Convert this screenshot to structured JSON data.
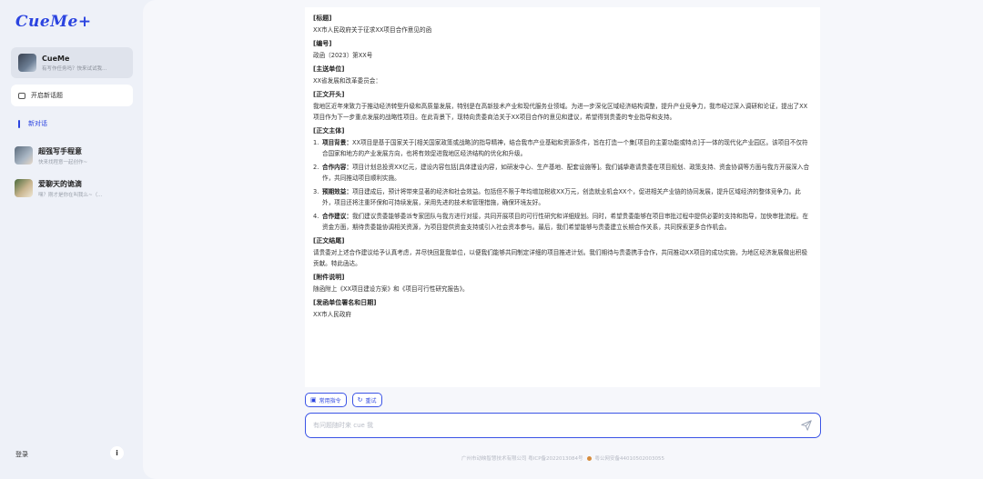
{
  "sidebar": {
    "logo": "CueMe+",
    "agent": {
      "name": "CueMe",
      "sub": "有写作任务吗？快来试试我..."
    },
    "new_topic": "开启新话题",
    "active_history": "新对话",
    "chats": [
      {
        "name": "超强写手程意",
        "sub": "快来找程意一起创作~"
      },
      {
        "name": "爱聊天的诡滴",
        "sub": "嘿？刚才是你在叫我么~（..."
      }
    ],
    "login": "登录"
  },
  "doc": {
    "sections": [
      {
        "title": "[标题]",
        "text": "XX市人民政府关于征求XX项目合作意见的函"
      },
      {
        "title": "[编号]",
        "text": "政函〔2023〕第XX号"
      },
      {
        "title": "[主送单位]",
        "text": "XX省发展和改革委员会："
      },
      {
        "title": "[正文开头]",
        "text": "我地区近年来致力于推动经济转型升级和高质量发展，特别是在高新技术产业和现代服务业领域。为进一步深化区域经济结构调整，提升产业竞争力，我市经过深入调研和论证，提出了XX项目作为下一步重点发展的战略性项目。在此背景下，现特向贵委商洽关于XX项目合作的意见和建议，希望得到贵委的专业指导和支持。"
      }
    ],
    "body_title": "[正文主体]",
    "items": [
      {
        "num": "1.",
        "label": "项目背景：",
        "text": "XX项目是基于国家关于[相关国家政策或战略]的指导精神，结合我市产业基础和资源条件，旨在打造一个集[项目的主要功能或特点]于一体的现代化产业园区。该项目不仅符合国家和地方的产业发展方向，也将有效促进我地区经济结构的优化和升级。"
      },
      {
        "num": "2.",
        "label": "合作内容：",
        "text": "项目计划总投资XX亿元，建设内容包括[具体建设内容，如研发中心、生产基地、配套设施等]。我们诚挚邀请贵委在项目规划、政策支持、资金协调等方面与我方开展深入合作，共同推动项目顺利实施。"
      },
      {
        "num": "3.",
        "label": "预期效益：",
        "text": "项目建成后，预计将带来显著的经济和社会效益。包括但不限于年均增加税收XX万元，创造就业机会XX个，促进相关产业链的协同发展，提升区域经济的整体竞争力。此外，项目还将注重环保和可持续发展，采用先进的技术和管理措施，确保环境友好。"
      },
      {
        "num": "4.",
        "label": "合作建议：",
        "text": "我们建议贵委能够委派专家团队与我方进行对接，共同开展项目的可行性研究和详细规划。同时，希望贵委能够在项目审批过程中提供必要的支持和指导，加快审批流程。在资金方面，期待贵委能协调相关资源，为项目提供资金支持或引入社会资本参与。最后，我们希望能够与贵委建立长期合作关系，共同探索更多合作机会。"
      }
    ],
    "sections_after": [
      {
        "title": "[正文结尾]",
        "text": "请贵委对上述合作建议给予认真考虑，并尽快回复我单位，以便我们能够共同制定详细的项目推进计划。我们期待与贵委携手合作，共同推动XX项目的成功实施，为地区经济发展做出积极贡献。特此函达。"
      },
      {
        "title": "[附件说明]",
        "text": "随函附上《XX项目建设方案》和《项目可行性研究报告》。"
      },
      {
        "title": "[发函单位署名和日期]",
        "text": "XX市人民政府"
      }
    ]
  },
  "chips": {
    "common": "常用指令",
    "retry": "重试"
  },
  "input": {
    "placeholder": "有问题随时来 cue 我"
  },
  "footer": {
    "icp": "广州市动映智慧技术有限公司 粤ICP备2022013084号",
    "police": "粤公网安备44010502003055"
  },
  "colors": {
    "accent": "#2b44e0",
    "bg": "#eef1f8"
  }
}
